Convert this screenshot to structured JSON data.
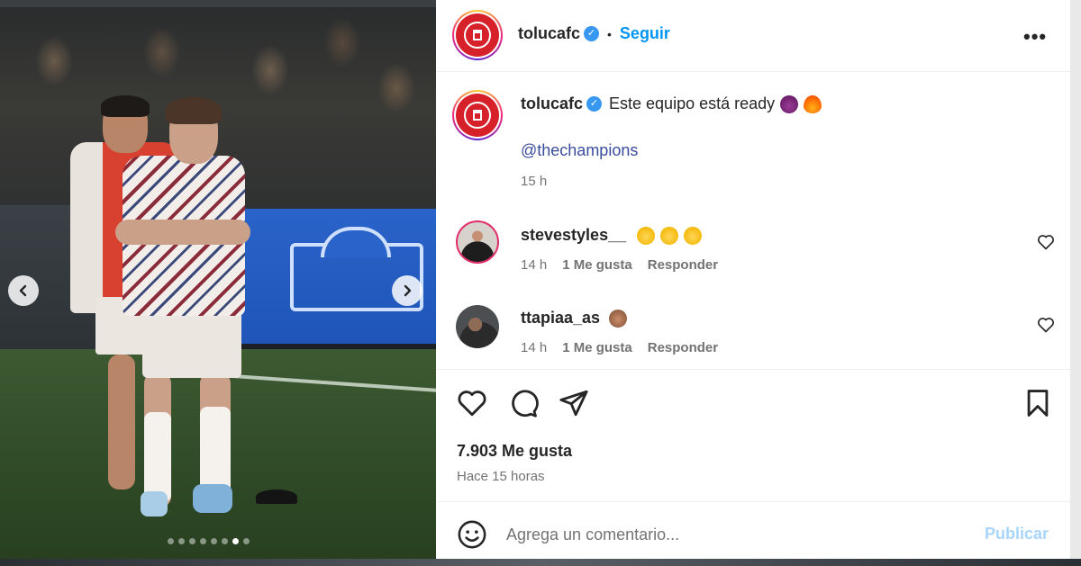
{
  "post": {
    "username": "tolucafc",
    "verified_icon": "verified-badge-icon",
    "bullet": "•",
    "follow_label": "Seguir",
    "more_label": "•••"
  },
  "caption": {
    "username": "tolucafc",
    "text": "Este equipo está ready",
    "emojis": [
      "devil-emoji",
      "fire-emoji"
    ],
    "mention": "@thechampions",
    "time": "15 h"
  },
  "comments": [
    {
      "username": "stevestyles__",
      "text": "",
      "emojis": [
        "clap-emoji",
        "clap-emoji",
        "clap-emoji"
      ],
      "time": "14 h",
      "likes": "1 Me gusta",
      "reply": "Responder"
    },
    {
      "username": "ttapiaa_as",
      "text": "",
      "emojis": [
        "monkey-emoji"
      ],
      "time": "14 h",
      "likes": "1 Me gusta",
      "reply": "Responder"
    }
  ],
  "stats": {
    "likes": "7.903 Me gusta",
    "posted": "Hace 15 horas"
  },
  "composer": {
    "placeholder": "Agrega un comentario...",
    "publish_label": "Publicar"
  },
  "carousel": {
    "count": 8,
    "active_index": 6
  },
  "colors": {
    "accent": "#0095f6",
    "publish_disabled": "#a8d5fb",
    "mention": "#3a4c9c",
    "muted": "#737373",
    "club_red": "#d6212b"
  }
}
